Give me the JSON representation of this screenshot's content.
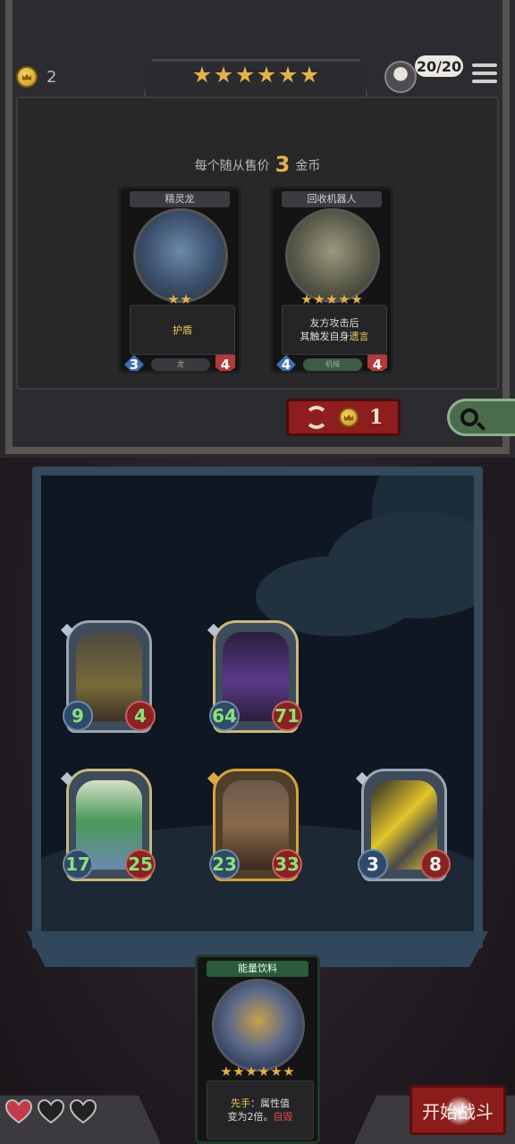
{
  "header": {
    "gold": "2",
    "tavern_stars": 6,
    "turn_counter": "20/20"
  },
  "shop": {
    "price_prefix": "每个随从售价",
    "price_value": "3",
    "price_suffix": "金币",
    "cards": [
      {
        "name": "精灵龙",
        "stars": 2,
        "desc_lines": [
          "护盾"
        ],
        "tribe": "龙",
        "attack": "3",
        "health": "4",
        "art_color": "#4a6d8a"
      },
      {
        "name": "回收机器人",
        "stars": 5,
        "desc_line1": "友方攻击后",
        "desc_line2_a": "其触发自身",
        "desc_line2_b": "遗言",
        "tribe": "机械",
        "attack": "4",
        "health": "4",
        "art_color": "#6a6a5a"
      }
    ],
    "refresh_cost": "1"
  },
  "board": {
    "minions": [
      {
        "id": "m1",
        "attack": "9",
        "health": "4",
        "golden": false,
        "atk_white": false,
        "hp_white": false,
        "art": "#6a5a3a"
      },
      {
        "id": "m2",
        "attack": "64",
        "health": "71",
        "golden": false,
        "atk_white": false,
        "hp_white": false,
        "art": "#4a2a6a"
      },
      {
        "id": "m3",
        "attack": "17",
        "health": "25",
        "golden": false,
        "atk_white": false,
        "hp_white": false,
        "art": "#4a8a4a"
      },
      {
        "id": "m4",
        "attack": "23",
        "health": "33",
        "golden": true,
        "atk_white": false,
        "hp_white": false,
        "art": "#6a4a2a"
      },
      {
        "id": "m5",
        "attack": "3",
        "health": "8",
        "golden": false,
        "atk_white": true,
        "hp_white": true,
        "art": "#7a6a1a"
      }
    ]
  },
  "hand": {
    "name": "能量饮料",
    "stars": 6,
    "desc_keyword": "先手",
    "desc_text1": "：属性值",
    "desc_text2": "变为2倍。",
    "desc_red": "自毁"
  },
  "lives": {
    "hearts": 3,
    "filled": 1
  },
  "start_button": "开始战斗",
  "colors": {
    "accent_gold": "#e6b04a",
    "button_red": "#8a1c1c",
    "health_text": "#8de07a"
  }
}
